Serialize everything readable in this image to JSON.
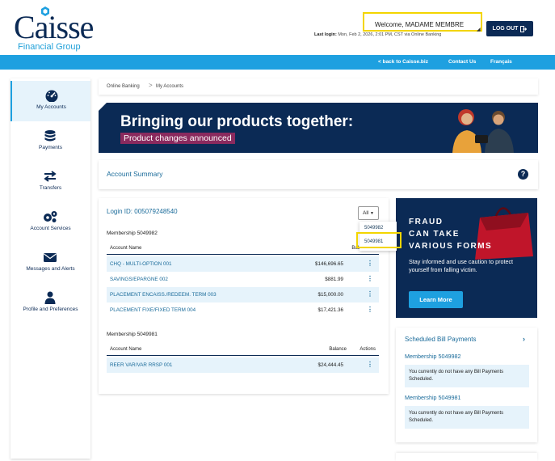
{
  "header": {
    "logo_text": "Caisse",
    "logo_subtitle": "Financial Group",
    "welcome": "Welcome, MADAME MEMBRE",
    "last_login_label": "Last login:",
    "last_login_value": "Mon, Feb 2, 2026, 2:01 PM, CST via Online Banking",
    "logout_label": "LOG OUT"
  },
  "topnav": {
    "back_link": "< back to Caisse.biz",
    "contact": "Contact Us",
    "language": "Français"
  },
  "sidebar": {
    "items": [
      {
        "label": "My Accounts",
        "icon": "gauge-icon"
      },
      {
        "label": "Payments",
        "icon": "coins-icon"
      },
      {
        "label": "Transfers",
        "icon": "transfer-arrows-icon"
      },
      {
        "label": "Account Services",
        "icon": "gears-icon"
      },
      {
        "label": "Messages and Alerts",
        "icon": "envelope-icon"
      },
      {
        "label": "Profile and Preferences",
        "icon": "person-icon"
      }
    ]
  },
  "breadcrumb": {
    "root": "Online Banking",
    "separator": ">",
    "current": "My Accounts"
  },
  "banner": {
    "title": "Bringing our products together:",
    "subtitle": "Product changes announced"
  },
  "summary": {
    "title": "Account Summary",
    "help": "?"
  },
  "accounts": {
    "login_id": "Login ID: 005079248540",
    "filter_label": "All",
    "filter_options": [
      "5049982",
      "5049981"
    ],
    "memberships": [
      {
        "title": "Membership 5049982",
        "headers": {
          "name": "Account Name",
          "balance": "Balance"
        },
        "rows": [
          {
            "name": "CHQ - MULTI-OPTION 001",
            "balance": "$146,696.65"
          },
          {
            "name": "SAVINGS/EPARGNE 002",
            "balance": "$881.99"
          },
          {
            "name": "PLACEMENT ENCAISS./REDEEM. TERM 003",
            "balance": "$15,000.00"
          },
          {
            "name": "PLACEMENT FIXE/FIXED TERM 004",
            "balance": "$17,421.36"
          }
        ]
      },
      {
        "title": "Membership 5049981",
        "headers": {
          "name": "Account Name",
          "balance": "Balance",
          "actions": "Actions"
        },
        "rows": [
          {
            "name": "REER VAR/VAR RRSP 001",
            "balance": "$24,444.45"
          }
        ]
      }
    ]
  },
  "promo": {
    "lines": [
      "FRAUD",
      "CAN TAKE",
      "VARIOUS FORMS"
    ],
    "body": "Stay informed and use caution to protect yourself from falling victim.",
    "button": "Learn More"
  },
  "bills": {
    "title": "Scheduled Bill Payments",
    "sections": [
      {
        "membership": "Membership 5049982",
        "message": "You currently do not have any Bill Payments Scheduled."
      },
      {
        "membership": "Membership 5049981",
        "message": "You currently do not have any Bill Payments Scheduled."
      }
    ]
  },
  "colors": {
    "navy": "#0b2a55",
    "accent_blue": "#1ea0e0",
    "highlight_yellow": "#f3d500",
    "row_shade": "#e6f3fb",
    "banner_tag": "#8a2a5e"
  }
}
